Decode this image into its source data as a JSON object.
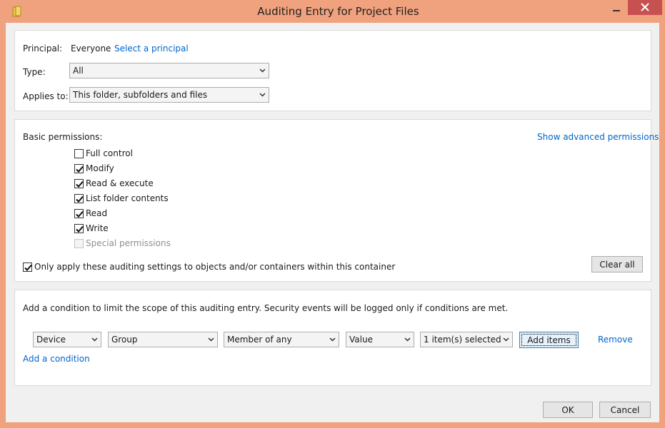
{
  "window": {
    "title": "Auditing Entry for Project Files"
  },
  "principal": {
    "label": "Principal:",
    "value": "Everyone",
    "link": "Select a principal"
  },
  "type": {
    "label": "Type:",
    "value": "All"
  },
  "applies_to": {
    "label": "Applies to:",
    "value": "This folder, subfolders and files"
  },
  "permissions": {
    "heading": "Basic permissions:",
    "advanced_link": "Show advanced permissions",
    "items": [
      {
        "label": "Full control",
        "checked": false,
        "disabled": false
      },
      {
        "label": "Modify",
        "checked": true,
        "disabled": false
      },
      {
        "label": "Read & execute",
        "checked": true,
        "disabled": false
      },
      {
        "label": "List folder contents",
        "checked": true,
        "disabled": false
      },
      {
        "label": "Read",
        "checked": true,
        "disabled": false
      },
      {
        "label": "Write",
        "checked": true,
        "disabled": false
      },
      {
        "label": "Special permissions",
        "checked": false,
        "disabled": true
      }
    ],
    "only_apply": {
      "label": "Only apply these auditing settings to objects and/or containers within this container",
      "checked": true
    },
    "clear_all": "Clear all"
  },
  "conditions": {
    "description": "Add a condition to limit the scope of this auditing entry. Security events will be logged only if conditions are met.",
    "row": {
      "attribute_source": "Device",
      "attribute": "Group",
      "operator": "Member of any",
      "value_type": "Value",
      "value": "1 item(s) selected",
      "add_items": "Add items",
      "remove": "Remove"
    },
    "add_condition": "Add a condition"
  },
  "footer": {
    "ok": "OK",
    "cancel": "Cancel"
  }
}
